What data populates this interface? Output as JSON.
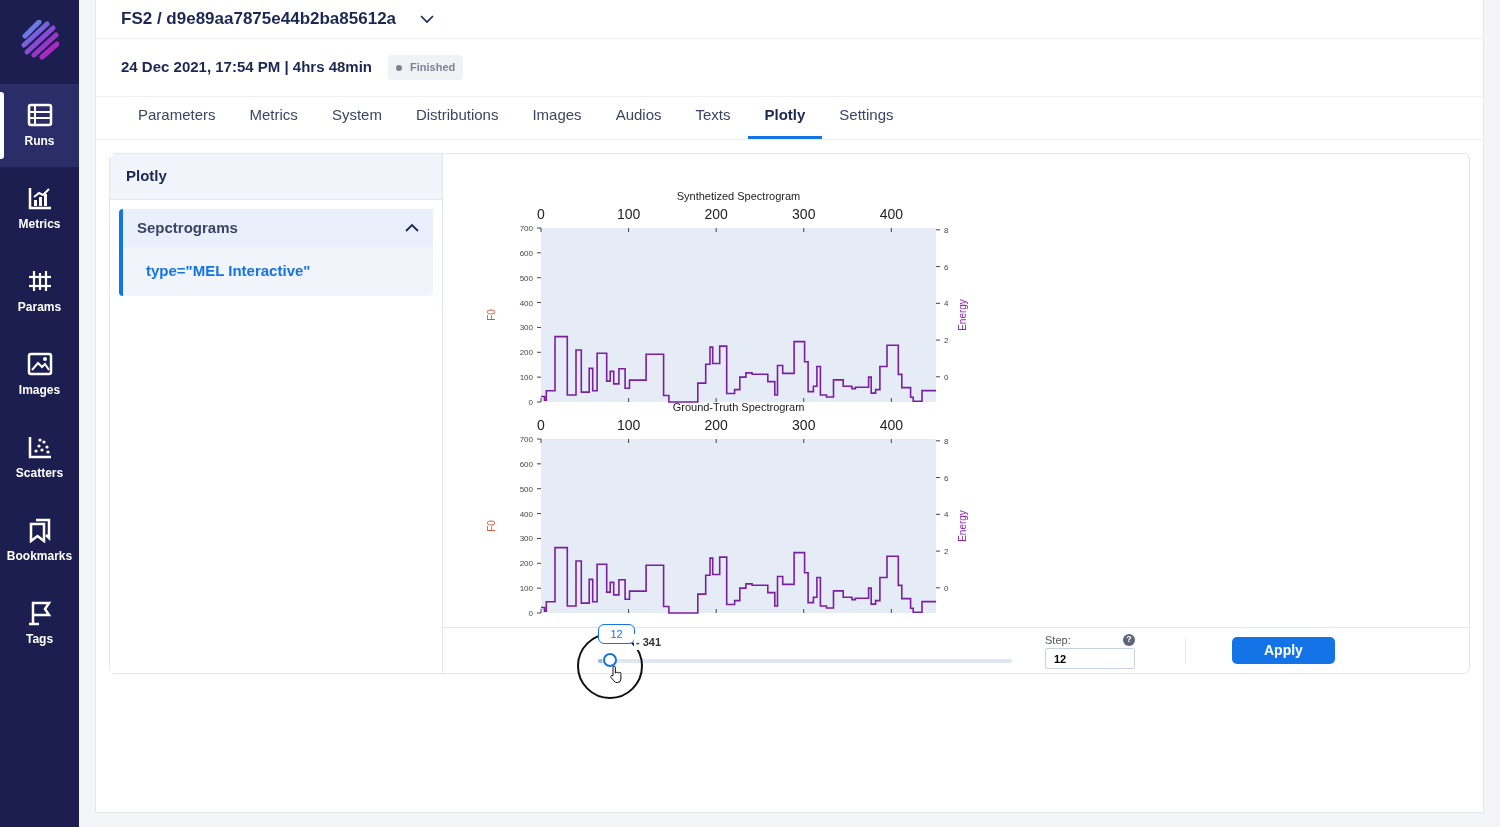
{
  "sidebar": {
    "items": [
      {
        "label": "Runs",
        "selected": true
      },
      {
        "label": "Metrics",
        "selected": false
      },
      {
        "label": "Params",
        "selected": false
      },
      {
        "label": "Images",
        "selected": false
      },
      {
        "label": "Scatters",
        "selected": false
      },
      {
        "label": "Bookmarks",
        "selected": false
      },
      {
        "label": "Tags",
        "selected": false
      }
    ]
  },
  "header": {
    "title": "FS2 / d9e89aa7875e44b2ba85612a",
    "run_info": "24 Dec 2021, 17:54 PM | 4hrs 48min",
    "status": "Finished"
  },
  "tabs": [
    {
      "label": "Parameters",
      "selected": false
    },
    {
      "label": "Metrics",
      "selected": false
    },
    {
      "label": "System",
      "selected": false
    },
    {
      "label": "Distributions",
      "selected": false
    },
    {
      "label": "Images",
      "selected": false
    },
    {
      "label": "Audios",
      "selected": false
    },
    {
      "label": "Texts",
      "selected": false
    },
    {
      "label": "Plotly",
      "selected": true
    },
    {
      "label": "Settings",
      "selected": false
    }
  ],
  "panel": {
    "title": "Plotly",
    "groups": [
      {
        "label": "Sepctrograms",
        "expanded": true,
        "items": [
          {
            "label": "type=\"MEL Interactive\"",
            "selected": true
          }
        ]
      }
    ]
  },
  "charts": [
    {
      "chart_data": {
        "type": "line",
        "title": "Synthetized Spectrogram",
        "ylabel": "F0",
        "y2label": "Energy",
        "xlim": [
          0,
          451
        ],
        "ylim": [
          0,
          700
        ],
        "y2lim": [
          -1.37,
          8.1
        ],
        "xticks": [
          0,
          100,
          200,
          300,
          400
        ],
        "yticks": [
          0,
          100,
          200,
          300,
          400,
          500,
          600,
          700
        ],
        "y2ticks": [
          0,
          2,
          4,
          6,
          8
        ],
        "x": [
          0,
          4,
          4,
          6,
          6,
          16,
          16,
          30,
          30,
          40,
          40,
          46,
          46,
          55,
          55,
          59,
          59,
          64,
          64,
          75,
          75,
          79,
          79,
          83,
          83,
          89,
          89,
          96,
          96,
          101,
          101,
          120,
          120,
          140,
          140,
          146,
          146,
          179,
          179,
          188,
          188,
          193,
          193,
          196,
          196,
          204,
          204,
          212,
          212,
          221,
          221,
          227,
          227,
          234,
          234,
          241,
          241,
          259,
          259,
          267,
          267,
          270,
          270,
          276,
          276,
          289,
          289,
          301,
          301,
          305,
          305,
          311,
          311,
          315,
          315,
          319,
          319,
          326,
          326,
          334,
          334,
          345,
          345,
          355,
          355,
          359,
          359,
          374,
          374,
          377,
          377,
          382,
          382,
          387,
          387,
          395,
          395,
          408,
          408,
          412,
          412,
          422,
          422,
          425,
          425,
          435,
          435,
          451
        ],
        "series": [
          {
            "color": "#7a1fa2",
            "values": [
              22,
              22,
              7,
              7,
              45,
              45,
              263,
              263,
              28,
              28,
              209,
              209,
              40,
              40,
              135,
              135,
              45,
              45,
              196,
              196,
              84,
              84,
              123,
              123,
              73,
              73,
              134,
              134,
              55,
              55,
              88,
              88,
              192,
              192,
              26,
              26,
              0,
              0,
              76,
              76,
              152,
              152,
              221,
              221,
              155,
              155,
              225,
              225,
              34,
              34,
              50,
              50,
              100,
              100,
              117,
              117,
              112,
              112,
              82,
              82,
              28,
              28,
              147,
              147,
              115,
              115,
              243,
              243,
              162,
              162,
              42,
              42,
              63,
              63,
              143,
              143,
              28,
              28,
              20,
              20,
              89,
              89,
              63,
              63,
              54,
              54,
              59,
              59,
              100,
              100,
              36,
              36,
              50,
              50,
              143,
              143,
              228,
              228,
              111,
              111,
              58,
              58,
              19,
              19,
              3,
              3,
              46,
              46
            ]
          }
        ]
      }
    },
    {
      "chart_data": {
        "type": "line",
        "title": "Ground-Truth Spectrogram",
        "ylabel": "F0",
        "y2label": "Energy",
        "xlim": [
          0,
          451
        ],
        "ylim": [
          0,
          700
        ],
        "y2lim": [
          -1.37,
          8.1
        ],
        "xticks": [
          0,
          100,
          200,
          300,
          400
        ],
        "yticks": [
          0,
          100,
          200,
          300,
          400,
          500,
          600,
          700
        ],
        "y2ticks": [
          0,
          2,
          4,
          6,
          8
        ],
        "x": [
          0,
          4,
          4,
          6,
          6,
          16,
          16,
          30,
          30,
          40,
          40,
          46,
          46,
          55,
          55,
          59,
          59,
          64,
          64,
          75,
          75,
          79,
          79,
          83,
          83,
          89,
          89,
          96,
          96,
          101,
          101,
          120,
          120,
          140,
          140,
          146,
          146,
          179,
          179,
          188,
          188,
          193,
          193,
          196,
          196,
          204,
          204,
          212,
          212,
          221,
          221,
          227,
          227,
          234,
          234,
          241,
          241,
          259,
          259,
          267,
          267,
          270,
          270,
          276,
          276,
          289,
          289,
          301,
          301,
          305,
          305,
          311,
          311,
          315,
          315,
          319,
          319,
          326,
          326,
          334,
          334,
          345,
          345,
          355,
          355,
          359,
          359,
          374,
          374,
          377,
          377,
          382,
          382,
          387,
          387,
          395,
          395,
          408,
          408,
          412,
          412,
          422,
          422,
          425,
          425,
          435,
          435,
          451
        ],
        "series": [
          {
            "color": "#7a1fa2",
            "values": [
              22,
              22,
              7,
              7,
              45,
              45,
              263,
              263,
              28,
              28,
              209,
              209,
              40,
              40,
              135,
              135,
              45,
              45,
              196,
              196,
              84,
              84,
              123,
              123,
              73,
              73,
              134,
              134,
              55,
              55,
              88,
              88,
              192,
              192,
              26,
              26,
              0,
              0,
              76,
              76,
              152,
              152,
              221,
              221,
              155,
              155,
              225,
              225,
              34,
              34,
              50,
              50,
              100,
              100,
              117,
              117,
              112,
              112,
              82,
              82,
              28,
              28,
              147,
              147,
              115,
              115,
              243,
              243,
              162,
              162,
              42,
              42,
              63,
              63,
              143,
              143,
              28,
              28,
              20,
              20,
              89,
              89,
              63,
              63,
              54,
              54,
              59,
              59,
              100,
              100,
              36,
              36,
              50,
              50,
              143,
              143,
              228,
              228,
              111,
              111,
              58,
              58,
              19,
              19,
              3,
              3,
              46,
              46
            ]
          }
        ]
      }
    }
  ],
  "slider": {
    "value": "12",
    "range_end": "- 341",
    "level": 0.03
  },
  "step": {
    "label": "Step:",
    "help": "?",
    "value": "12"
  },
  "apply": "Apply"
}
